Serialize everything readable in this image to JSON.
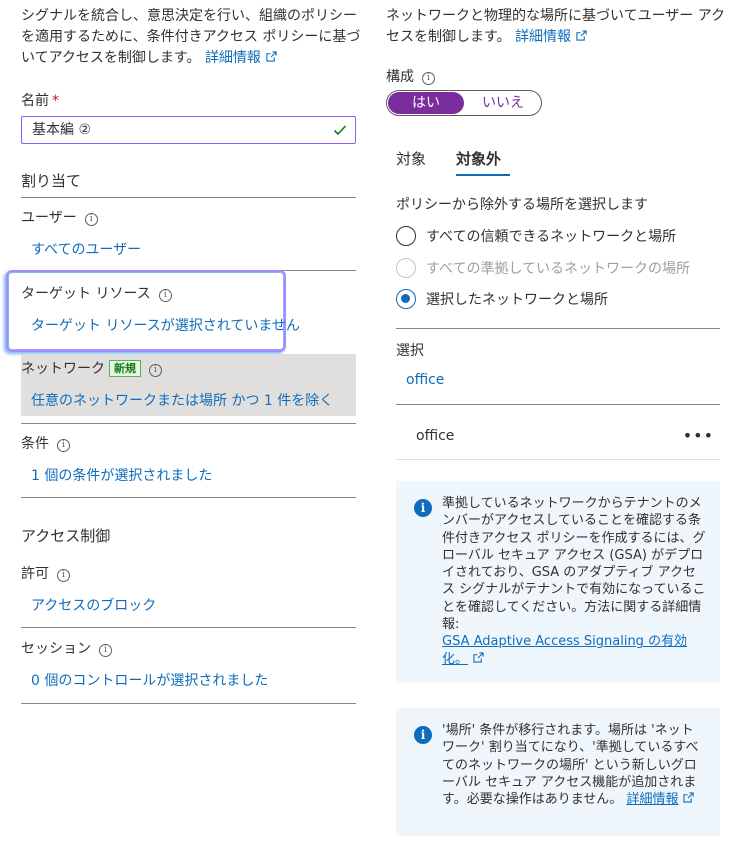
{
  "left": {
    "intro_text": "シグナルを統合し、意思決定を行い、組織のポリシーを適用するために、条件付きアクセス ポリシーに基づいてアクセスを制御します。",
    "intro_link": "詳細情報",
    "name_label": "名前",
    "name_required": "*",
    "name_value": "基本編 ②",
    "assignments_heading": "割り当て",
    "users_label": "ユーザー",
    "users_value": "すべてのユーザー",
    "target_label": "ターゲット リソース",
    "target_value": "ターゲット リソースが選択されていません",
    "network_label": "ネットワーク",
    "network_badge": "新規",
    "network_value": "任意のネットワークまたは場所 かつ 1 件を除く",
    "conditions_label": "条件",
    "conditions_value": "1 個の条件が選択されました",
    "access_heading": "アクセス制御",
    "grant_label": "許可",
    "grant_value": "アクセスのブロック",
    "session_label": "セッション",
    "session_value": "0 個のコントロールが選択されました"
  },
  "right": {
    "intro_text": "ネットワークと物理的な場所に基づいてユーザー アクセスを制御します。",
    "intro_link": "詳細情報",
    "configure_label": "構成",
    "toggle_yes": "はい",
    "toggle_no": "いいえ",
    "tab_include": "対象",
    "tab_exclude": "対象外",
    "exclude_prompt": "ポリシーから除外する場所を選択します",
    "radio_options": [
      "すべての信頼できるネットワークと場所",
      "すべての準拠しているネットワークの場所",
      "選択したネットワークと場所"
    ],
    "selected_radio": "選択したネットワークと場所",
    "select_label": "選択",
    "select_link": "office",
    "selected_item": "office",
    "more_menu": "•••",
    "info1_text": "準拠しているネットワークからテナントのメンバーがアクセスしていることを確認する条件付きアクセス ポリシーを作成するには、グローバル セキュア アクセス (GSA) がデプロイされており、GSA のアダプティブ アクセス シグナルがテナントで有効になっていることを確認してください。方法に関する詳細情報:",
    "info1_link": "GSA Adaptive Access Signaling の有効化。",
    "info2_text": "'場所' 条件が移行されます。場所は 'ネットワーク' 割り当てになり、'準拠しているすべてのネットワークの場所' という新しいグローバル セキュア アクセス機能が追加されます。必要な操作はありません。",
    "info2_link": "詳細情報"
  },
  "colors": {
    "link": "#0f6cbd",
    "toggle_active": "#7b2d9e",
    "input_border": "#8b5cf6",
    "info_background": "#eff6fc",
    "badge_green": "#107c10"
  },
  "icons": [
    "external-link-icon",
    "info-icon",
    "checkmark-icon",
    "more-icon",
    "info-filled-icon"
  ]
}
